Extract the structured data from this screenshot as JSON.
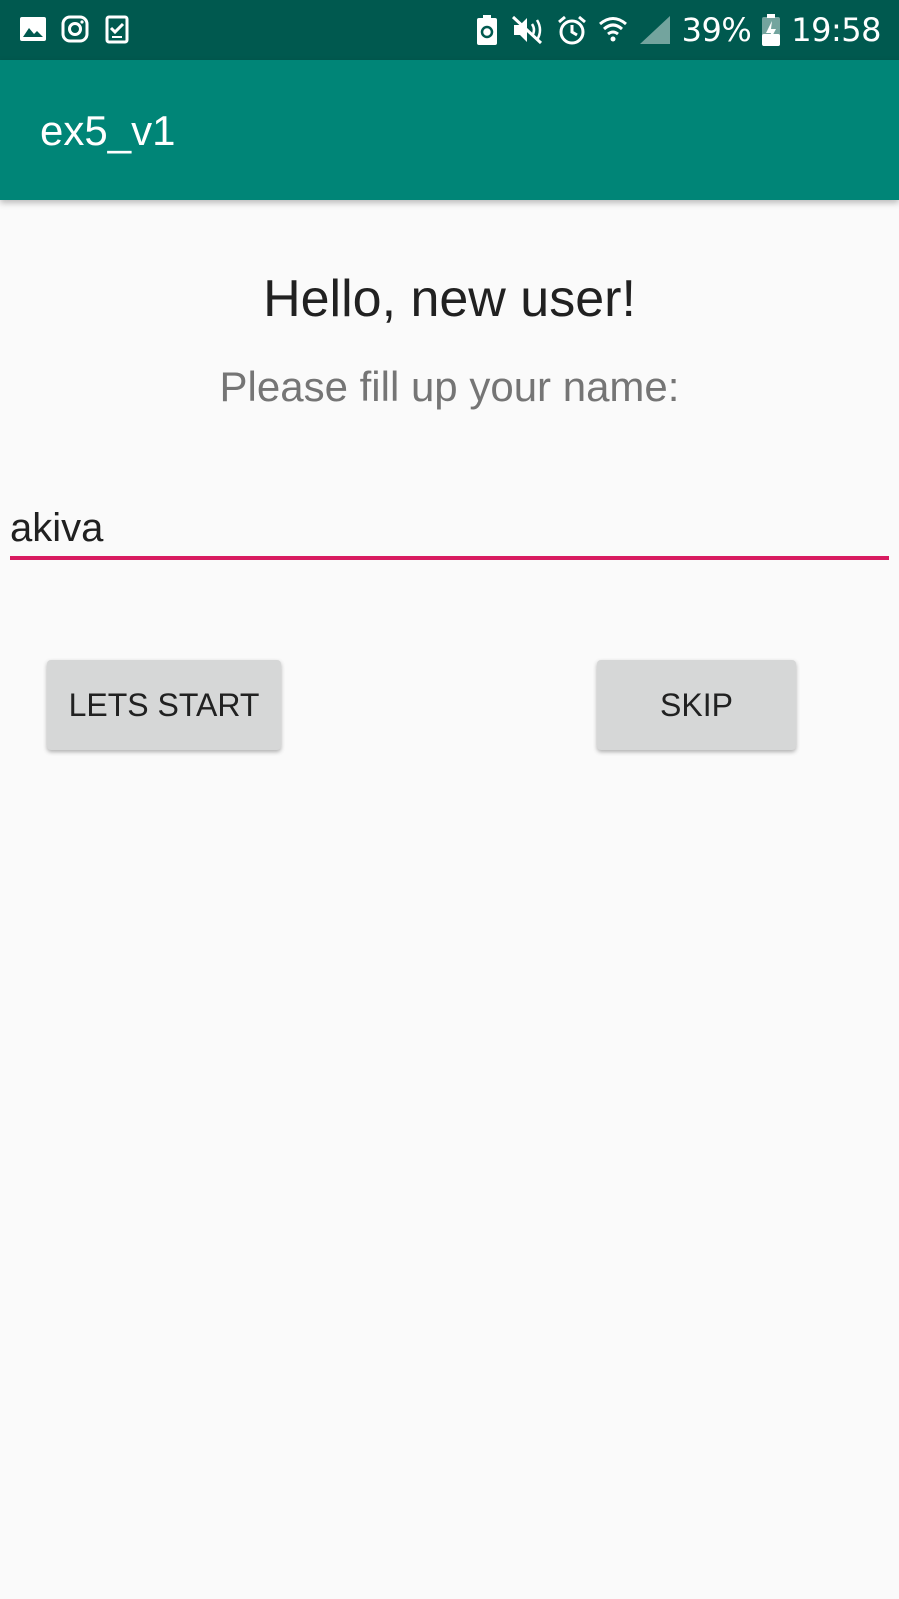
{
  "status_bar": {
    "battery": "39%",
    "time": "19:58",
    "left_icons": [
      "image-icon",
      "instagram-icon",
      "task-icon"
    ],
    "right_icons": [
      "battery-saver-icon",
      "mute-icon",
      "alarm-icon",
      "wifi-icon",
      "signal-icon",
      "battery-charging-icon"
    ]
  },
  "app_bar": {
    "title": "ex5_v1"
  },
  "main": {
    "greeting": "Hello, new user!",
    "prompt": "Please fill up your name:",
    "name_input_value": "akiva",
    "start_label": "LETS START",
    "skip_label": "SKIP"
  },
  "colors": {
    "status_bar": "#00594f",
    "app_bar": "#008577",
    "accent": "#d81b60",
    "background": "#fafafa",
    "button": "#d6d7d7"
  }
}
